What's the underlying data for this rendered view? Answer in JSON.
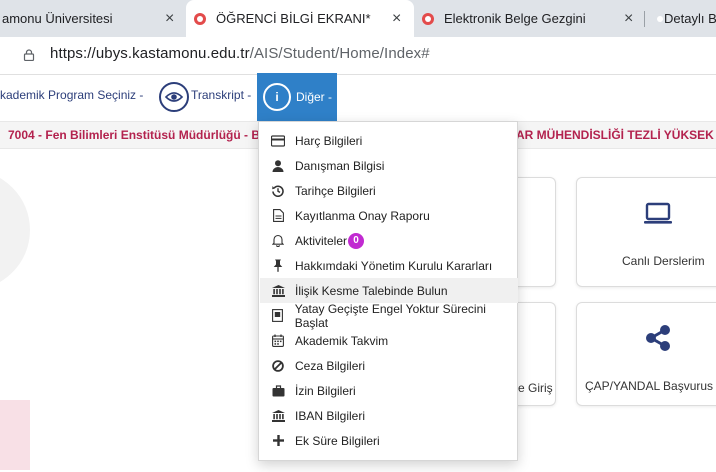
{
  "browser": {
    "tabs": [
      {
        "title": "amonu Üniversitesi",
        "active": false
      },
      {
        "title": "ÖĞRENCİ BİLGİ EKRANI*",
        "active": true
      },
      {
        "title": "Elektronik Belge Gezgini",
        "active": false
      },
      {
        "title": "Detaylı B",
        "active": false
      }
    ],
    "close_glyph": "×",
    "url_host": "https://ubys.kastamonu.edu.tr",
    "url_path": "/AIS/Student/Home/Index#"
  },
  "nav": {
    "program_label": "kademik Program Seçiniz -",
    "transcript_label": "Transkript -",
    "info_glyph": "i",
    "other_label": "Diğer -"
  },
  "banner": {
    "left_text": "7004 - Fen Bilimleri Enstitüsü Müdürlüğü - Bil",
    "right_text": "AR MÜHENDİSLİĞİ TEZLİ YÜKSEK Lİ"
  },
  "cards": {
    "online_courses": "Canlı Derslerim",
    "partial_entry": "e Giriş",
    "cap_yandal": "ÇAP/YANDAL Başvurus"
  },
  "menu": {
    "items": [
      {
        "label": "Harç Bilgileri",
        "icon": "credit-card-icon"
      },
      {
        "label": "Danışman Bilgisi",
        "icon": "user-icon"
      },
      {
        "label": "Tarihçe Bilgileri",
        "icon": "history-icon"
      },
      {
        "label": "Kayıtlanma Onay Raporu",
        "icon": "report-icon"
      },
      {
        "label": "Aktiviteler",
        "icon": "bell-icon",
        "badge": "0"
      },
      {
        "label": "Hakkımdaki Yönetim Kurulu Kararları",
        "icon": "pin-icon"
      },
      {
        "label": "İlişik Kesme Talebinde Bulun",
        "icon": "institution-icon"
      },
      {
        "label": "Yatay Geçişte Engel Yoktur Sürecini Başlat",
        "icon": "document-icon"
      },
      {
        "label": "Akademik Takvim",
        "icon": "calendar-icon"
      },
      {
        "label": "Ceza Bilgileri",
        "icon": "ban-icon"
      },
      {
        "label": "İzin Bilgileri",
        "icon": "briefcase-icon"
      },
      {
        "label": "IBAN Bilgileri",
        "icon": "bank-icon"
      },
      {
        "label": "Ek Süre Bilgileri",
        "icon": "plus-icon"
      }
    ],
    "highlighted_index": 6
  },
  "colors": {
    "accent": "#2f80c8",
    "nav_text": "#2c3e7a",
    "banner_text": "#b3224e",
    "badge": "#c12ad1",
    "favicon": "#e34b4b"
  }
}
